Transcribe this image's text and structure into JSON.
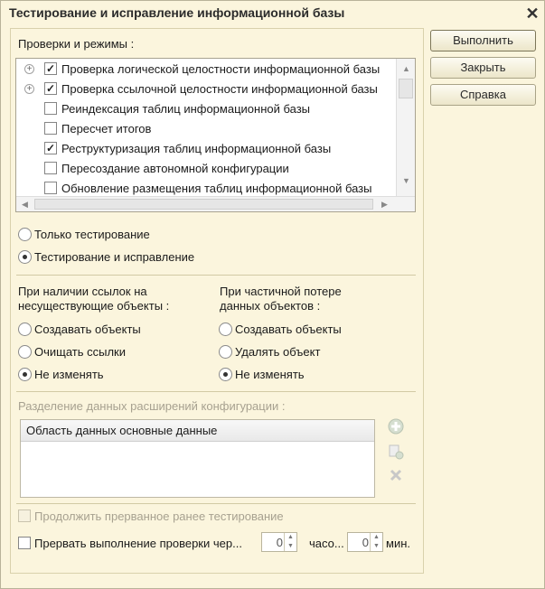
{
  "window": {
    "title": "Тестирование и исправление информационной базы"
  },
  "buttons": {
    "execute": "Выполнить",
    "close": "Закрыть",
    "help": "Справка"
  },
  "checks": {
    "label": "Проверки и режимы :",
    "items": [
      {
        "label": "Проверка логической целостности информационной базы",
        "checked": true,
        "expandable": true
      },
      {
        "label": "Проверка ссылочной целостности информационной базы",
        "checked": true,
        "expandable": true
      },
      {
        "label": "Реиндексация таблиц информационной базы",
        "checked": false,
        "expandable": false
      },
      {
        "label": "Пересчет итогов",
        "checked": false,
        "expandable": false
      },
      {
        "label": "Реструктуризация таблиц информационной базы",
        "checked": true,
        "expandable": false
      },
      {
        "label": "Пересоздание автономной конфигурации",
        "checked": false,
        "expandable": false
      },
      {
        "label": "Обновление размещения таблиц информационной базы",
        "checked": false,
        "expandable": false
      }
    ]
  },
  "mode": {
    "option_test_only": "Только тестирование",
    "option_test_and_fix": "Тестирование и исправление",
    "selected": "option_test_and_fix"
  },
  "refs": {
    "title_line1": "При наличии ссылок на",
    "title_line2": "несуществующие объекты :",
    "options": [
      "Создавать объекты",
      "Очищать ссылки",
      "Не изменять"
    ],
    "selected": 2
  },
  "partial": {
    "title_line1": "При частичной потере",
    "title_line2": "данных объектов :",
    "options": [
      "Создавать объекты",
      "Удалять объект",
      "Не изменять"
    ],
    "selected": 2
  },
  "extensions": {
    "label": "Разделение данных расширений конфигурации :",
    "column_header": "Область данных основные данные"
  },
  "continue_label": "Продолжить прерванное ранее тестирование",
  "interrupt": {
    "label": "Прервать выполнение проверки чер...",
    "hours_value": "0",
    "hours_label": "часо...",
    "minutes_value": "0",
    "minutes_label": "мин."
  },
  "icons": {
    "add": "add-icon",
    "copy": "copy-icon",
    "delete": "delete-icon"
  }
}
